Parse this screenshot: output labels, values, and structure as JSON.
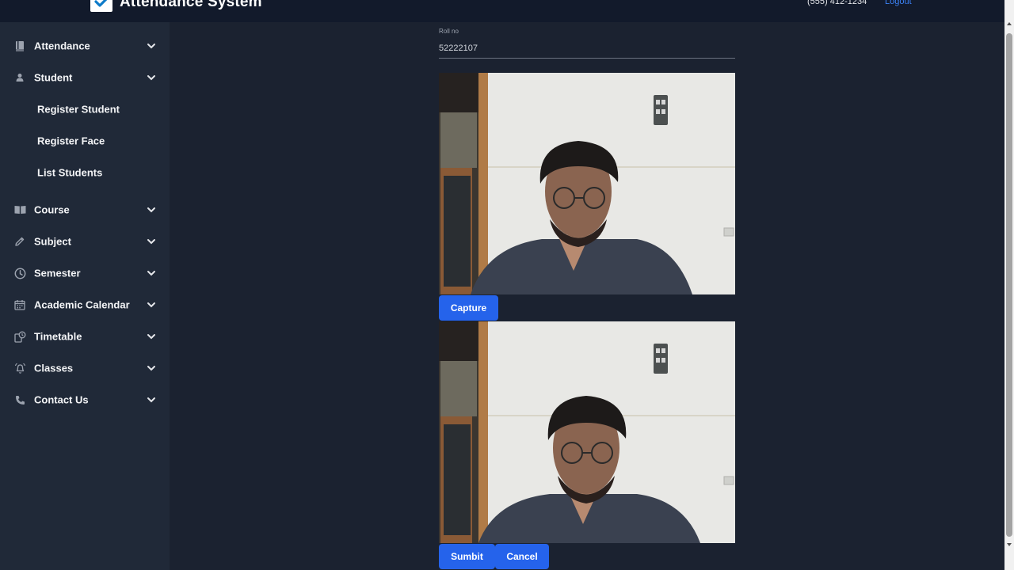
{
  "header": {
    "app_title": "Attendance System",
    "phone": "(555) 412-1234",
    "logout_label": "Logout"
  },
  "sidebar": {
    "items": [
      {
        "label": "Attendance",
        "icon": "book-icon"
      },
      {
        "label": "Student",
        "icon": "user-icon"
      },
      {
        "label": "Course",
        "icon": "open-book-icon"
      },
      {
        "label": "Subject",
        "icon": "pencil-icon"
      },
      {
        "label": "Semester",
        "icon": "clock-icon"
      },
      {
        "label": "Academic Calendar",
        "icon": "calendar-icon"
      },
      {
        "label": "Timetable",
        "icon": "timetable-icon"
      },
      {
        "label": "Classes",
        "icon": "bell-icon"
      },
      {
        "label": "Contact Us",
        "icon": "phone-icon"
      }
    ],
    "student_subitems": [
      "Register Student",
      "Register Face",
      "List Students"
    ]
  },
  "form": {
    "roll_label": "Roll no",
    "roll_value": "52222107",
    "capture_label": "Capture",
    "submit_label": "Sumbit",
    "cancel_label": "Cancel"
  },
  "colors": {
    "background": "#1b2230",
    "sidebar": "#202938",
    "topbar": "#121a2b",
    "accent": "#2563eb",
    "link": "#3b82f6"
  }
}
